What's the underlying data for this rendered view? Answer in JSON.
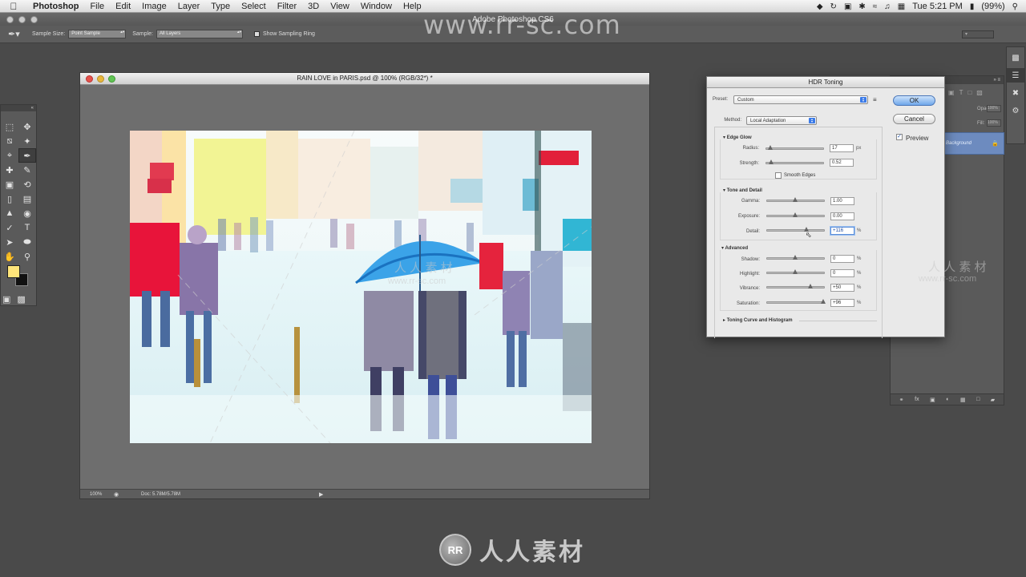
{
  "menubar": {
    "items": [
      "Photoshop",
      "File",
      "Edit",
      "Image",
      "Layer",
      "Type",
      "Select",
      "Filter",
      "3D",
      "View",
      "Window",
      "Help"
    ],
    "clock": "Tue 5:21 PM",
    "battery": "(99%)"
  },
  "app": {
    "title": "Adobe Photoshop CS6"
  },
  "options": {
    "sample_size_label": "Sample Size:",
    "sample_size_value": "Point Sample",
    "sample_label": "Sample:",
    "sample_value": "All Layers",
    "show_ring_label": "Show Sampling Ring"
  },
  "document": {
    "title": "RAIN LOVE in PARIS.psd @ 100% (RGB/32*) *",
    "zoom": "100%",
    "doc_info": "Doc: 5.78M/5.78M"
  },
  "hdr": {
    "title": "HDR Toning",
    "preset_label": "Preset:",
    "preset_value": "Custom",
    "method_label": "Method:",
    "method_value": "Local Adaptation",
    "ok_label": "OK",
    "cancel_label": "Cancel",
    "preview_label": "Preview",
    "edge_glow": {
      "title": "Edge Glow",
      "radius_label": "Radius:",
      "radius_value": "17",
      "radius_unit": "px",
      "strength_label": "Strength:",
      "strength_value": "0.52",
      "smooth_edges_label": "Smooth Edges"
    },
    "tone_detail": {
      "title": "Tone and Detail",
      "gamma_label": "Gamma:",
      "gamma_value": "1.00",
      "exposure_label": "Exposure:",
      "exposure_value": "0.00",
      "detail_label": "Detail:",
      "detail_value": "+116",
      "detail_unit": "%"
    },
    "advanced": {
      "title": "Advanced",
      "shadow_label": "Shadow:",
      "shadow_value": "0",
      "highlight_label": "Highlight:",
      "highlight_value": "0",
      "vibrance_label": "Vibrance:",
      "vibrance_value": "+50",
      "saturation_label": "Saturation:",
      "saturation_value": "+96",
      "unit": "%"
    },
    "toning_curve_label": "Toning Curve and Histogram"
  },
  "layers": {
    "opacity_label": "Opacity:",
    "opacity_value": "100%",
    "fill_label": "Fill:",
    "fill_value": "100%",
    "layer_name": "Background"
  },
  "watermarks": {
    "top": "www.rr-sc.com",
    "logo_text": "人人素材",
    "mid_cn": "人 人 素 材",
    "mid_url": "www.rr-sc.com"
  }
}
